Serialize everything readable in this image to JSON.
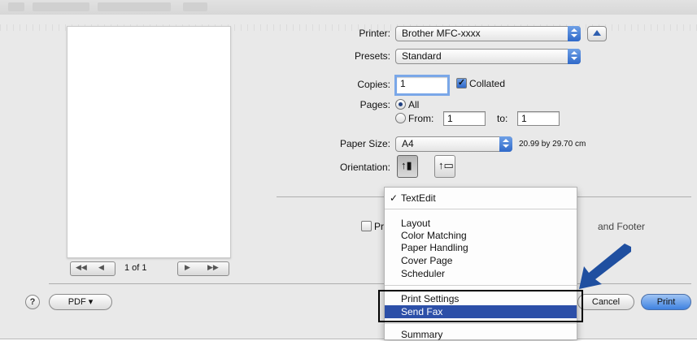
{
  "printer": {
    "label": "Printer:",
    "value": "Brother MFC-xxxx"
  },
  "presets": {
    "label": "Presets:",
    "value": "Standard"
  },
  "copies": {
    "label": "Copies:",
    "value": "1",
    "collated_label": "Collated",
    "collated_checked": true
  },
  "pages": {
    "label": "Pages:",
    "all_label": "All",
    "from_label": "From:",
    "from_value": "1",
    "to_label": "to:",
    "to_value": "1",
    "selected": "All"
  },
  "paper_size": {
    "label": "Paper Size:",
    "value": "A4",
    "dimensions": "20.99 by 29.70 cm"
  },
  "orientation": {
    "label": "Orientation:",
    "options": [
      "portrait",
      "landscape"
    ],
    "selected": "portrait"
  },
  "preview": {
    "page_indicator": "1 of 1"
  },
  "background_option": {
    "label_start": "Pr",
    "label_end": "and Footer"
  },
  "menu": {
    "checked_item": "TextEdit",
    "items": [
      "TextEdit",
      "Layout",
      "Color Matching",
      "Paper Handling",
      "Cover Page",
      "Scheduler",
      "Print Settings",
      "Send Fax",
      "Summary"
    ],
    "highlighted": "Send Fax"
  },
  "buttons": {
    "help": "?",
    "pdf": "PDF ▾",
    "cancel": "Cancel",
    "print": "Print"
  },
  "colors": {
    "accent": "#2c4fa8",
    "annotation_arrow": "#1f4fa0"
  }
}
